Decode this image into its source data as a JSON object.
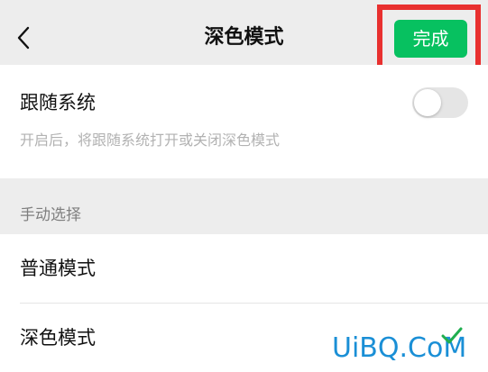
{
  "header": {
    "title": "深色模式",
    "done_label": "完成",
    "back_icon": "chevron-left-icon"
  },
  "follow_system": {
    "label": "跟随系统",
    "description": "开启后，将跟随系统打开或关闭深色模式",
    "enabled": false
  },
  "manual": {
    "section_title": "手动选择",
    "options": [
      {
        "label": "普通模式"
      },
      {
        "label": "深色模式"
      }
    ]
  },
  "watermark": {
    "text": "UiBQ.CoM"
  },
  "colors": {
    "accent": "#07c160",
    "highlight": "#e8302f",
    "watermark": "#1a8fd6"
  }
}
